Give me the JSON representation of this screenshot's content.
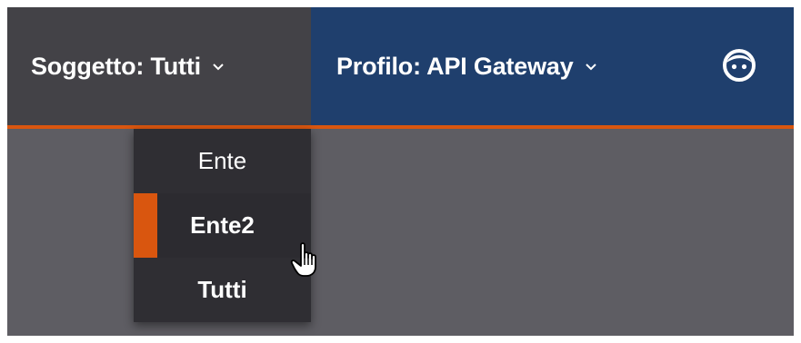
{
  "header": {
    "soggetto_label": "Soggetto: Tutti",
    "profilo_label": "Profilo: API Gateway",
    "chevron_icon": "chevron-down-icon",
    "user_icon": "user-face-icon"
  },
  "dropdown": {
    "items": [
      {
        "label": "Ente",
        "selected": false
      },
      {
        "label": "Ente2",
        "selected": true
      },
      {
        "label": "Tutti",
        "selected": false
      }
    ]
  },
  "colors": {
    "accent": "#d9560f",
    "profilo_bg": "#1f3f6d",
    "soggetto_bg": "#434247",
    "content_bg": "#5e5d63",
    "dropdown_bg": "#2f2e33"
  }
}
